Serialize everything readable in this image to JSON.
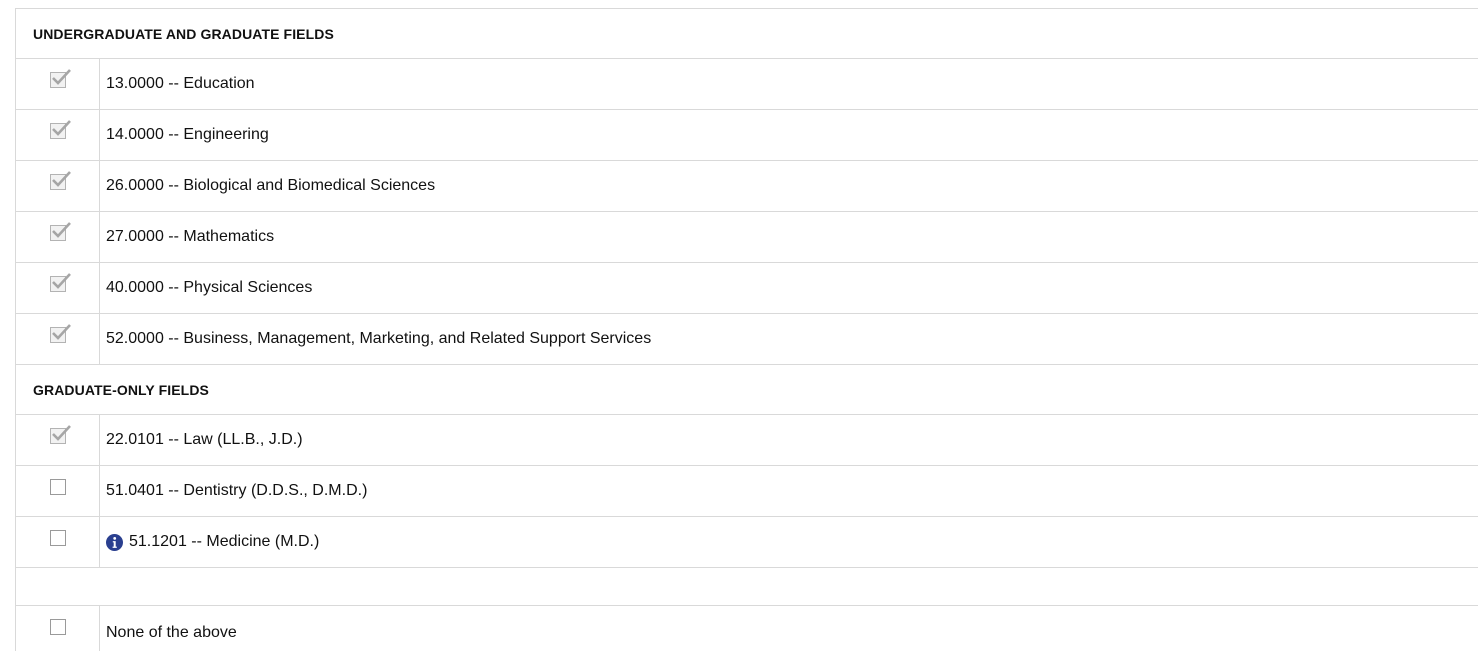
{
  "sections": [
    {
      "title": "UNDERGRADUATE AND GRADUATE FIELDS",
      "items": [
        {
          "label": "13.0000 -- Education",
          "checked": true
        },
        {
          "label": "14.0000 -- Engineering",
          "checked": true
        },
        {
          "label": "26.0000 -- Biological and Biomedical Sciences",
          "checked": true
        },
        {
          "label": "27.0000 -- Mathematics",
          "checked": true
        },
        {
          "label": "40.0000 -- Physical Sciences",
          "checked": true
        },
        {
          "label": "52.0000 -- Business, Management, Marketing, and Related Support Services",
          "checked": true
        }
      ]
    },
    {
      "title": "GRADUATE-ONLY FIELDS",
      "items": [
        {
          "label": "22.0101 -- Law (LL.B., J.D.)",
          "checked": true
        },
        {
          "label": "51.0401 -- Dentistry (D.D.S., D.M.D.)",
          "checked": false
        },
        {
          "label": "51.1201 -- Medicine (M.D.)",
          "checked": false,
          "icon": "info-icon"
        }
      ]
    }
  ],
  "none_option": {
    "label": "None of the above",
    "checked": false
  },
  "colors": {
    "info_icon": "#2a3f8f",
    "checkmark": "#a6a6a6",
    "border": "#d9d9d9"
  }
}
